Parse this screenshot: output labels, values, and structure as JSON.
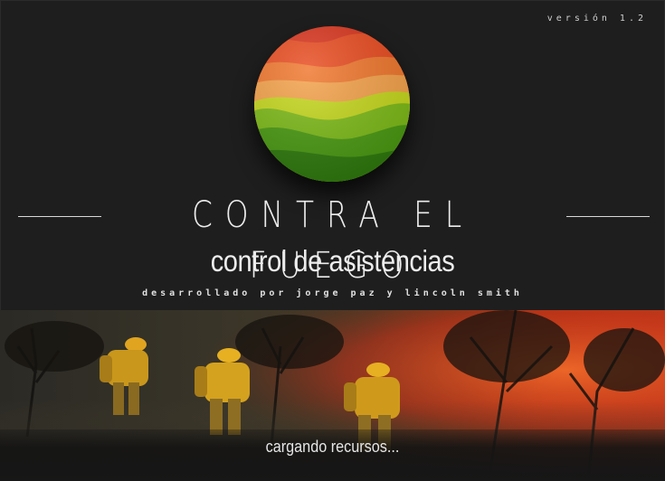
{
  "app": {
    "version": "versión 1.2",
    "title": "CONTRA EL FUEGO",
    "subtitle": "control de asistencias",
    "credits": "desarrollado por jorge paz y lincoln smith",
    "status": "cargando recursos..."
  },
  "icons": {
    "logo": "landscape-sphere-logo",
    "photo": "firefighters-photo"
  },
  "colors": {
    "background": "#1e1e1e",
    "text": "#ececec",
    "logo_red": "#e03a1c",
    "logo_orange": "#f39a3a",
    "logo_green": "#4a9a12",
    "fire": "#c8401a"
  }
}
